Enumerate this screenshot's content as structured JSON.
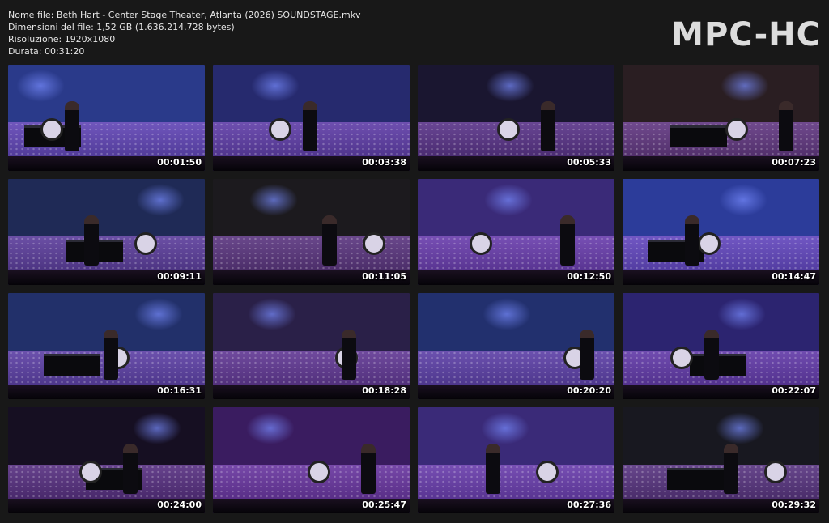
{
  "file_info": {
    "name": "Nome file: Beth Hart - Center Stage Theater, Atlanta (2026) SOUNDSTAGE.mkv",
    "size": "Dimensioni del file: 1,52 GB (1.636.214.728 bytes)",
    "resolution": "Risoluzione: 1920x1080",
    "duration": "Durata: 00:31:20"
  },
  "logo": "MPC-HC",
  "thumbnails": [
    {
      "time": "00:01:50",
      "bg": "#2a3a8a"
    },
    {
      "time": "00:03:38",
      "bg": "#262a6e"
    },
    {
      "time": "00:05:33",
      "bg": "#1a1630"
    },
    {
      "time": "00:07:23",
      "bg": "#2a1e22"
    },
    {
      "time": "00:09:11",
      "bg": "#1f2a56"
    },
    {
      "time": "00:11:05",
      "bg": "#1c1a1e"
    },
    {
      "time": "00:12:50",
      "bg": "#3a2a78"
    },
    {
      "time": "00:14:47",
      "bg": "#2c3c9a"
    },
    {
      "time": "00:16:31",
      "bg": "#22306a"
    },
    {
      "time": "00:18:28",
      "bg": "#2a2048"
    },
    {
      "time": "00:20:20",
      "bg": "#22306e"
    },
    {
      "time": "00:22:07",
      "bg": "#2c2470"
    },
    {
      "time": "00:24:00",
      "bg": "#160f22"
    },
    {
      "time": "00:25:47",
      "bg": "#3a1c60"
    },
    {
      "time": "00:27:36",
      "bg": "#3a2a78"
    },
    {
      "time": "00:29:32",
      "bg": "#181820"
    }
  ]
}
